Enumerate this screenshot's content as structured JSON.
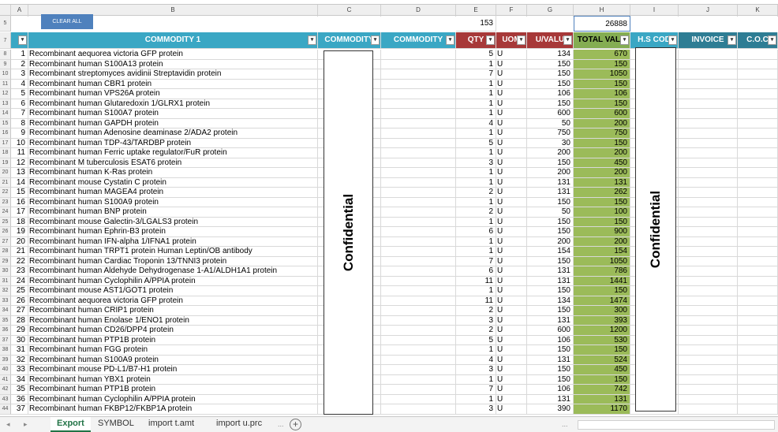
{
  "column_letters": [
    "A",
    "B",
    "C",
    "D",
    "E",
    "F",
    "G",
    "H",
    "I",
    "J",
    "K"
  ],
  "toolbar": {
    "clear_all": "CLEAR ALL",
    "qty_total": "153",
    "value_total": "26888"
  },
  "headers": [
    {
      "key": "no",
      "label": ""
    },
    {
      "key": "commodity1",
      "label": "COMMODITY 1"
    },
    {
      "key": "commodity2",
      "label": "COMMODITY"
    },
    {
      "key": "commodity3",
      "label": "COMMODITY"
    },
    {
      "key": "qty",
      "label": "QTY"
    },
    {
      "key": "uom",
      "label": "UOM"
    },
    {
      "key": "uvalue",
      "label": "U/VALU"
    },
    {
      "key": "total",
      "label": "TOTAL VALU"
    },
    {
      "key": "hscode",
      "label": "H.S COD"
    },
    {
      "key": "invoice",
      "label": "INVOICE"
    },
    {
      "key": "coo",
      "label": "C.O.C"
    }
  ],
  "filter_icon": "dropdown-arrow-icon",
  "confidential_label": "Confidential",
  "rows": [
    {
      "r": "8",
      "no": "1",
      "name": "Recombinant aequorea victoria GFP protein",
      "qty": "5",
      "uom": "U",
      "uval": "134",
      "total": "670"
    },
    {
      "r": "9",
      "no": "2",
      "name": "Recombinant human S100A13 protein",
      "qty": "1",
      "uom": "U",
      "uval": "150",
      "total": "150"
    },
    {
      "r": "10",
      "no": "3",
      "name": "Recombinant streptomyces avidinii Streptavidin protein",
      "qty": "7",
      "uom": "U",
      "uval": "150",
      "total": "1050"
    },
    {
      "r": "11",
      "no": "4",
      "name": "Recombinant human CBR1 protein",
      "qty": "1",
      "uom": "U",
      "uval": "150",
      "total": "150"
    },
    {
      "r": "12",
      "no": "5",
      "name": "Recombinant human VPS26A protein",
      "qty": "1",
      "uom": "U",
      "uval": "106",
      "total": "106"
    },
    {
      "r": "13",
      "no": "6",
      "name": "Recombinant human Glutaredoxin 1/GLRX1 protein",
      "qty": "1",
      "uom": "U",
      "uval": "150",
      "total": "150"
    },
    {
      "r": "14",
      "no": "7",
      "name": "Recombinant human S100A7 protein",
      "qty": "1",
      "uom": "U",
      "uval": "600",
      "total": "600"
    },
    {
      "r": "15",
      "no": "8",
      "name": "Recombinant human GAPDH protein",
      "qty": "4",
      "uom": "U",
      "uval": "50",
      "total": "200"
    },
    {
      "r": "16",
      "no": "9",
      "name": "Recombinant human Adenosine deaminase 2/ADA2 protein",
      "qty": "1",
      "uom": "U",
      "uval": "750",
      "total": "750"
    },
    {
      "r": "17",
      "no": "10",
      "name": "Recombinant human TDP-43/TARDBP protein",
      "qty": "5",
      "uom": "U",
      "uval": "30",
      "total": "150"
    },
    {
      "r": "18",
      "no": "11",
      "name": "Recombinant human Ferric uptake regulator/FuR protein",
      "qty": "1",
      "uom": "U",
      "uval": "200",
      "total": "200"
    },
    {
      "r": "19",
      "no": "12",
      "name": "Recombinant M tuberculosis ESAT6 protein",
      "qty": "3",
      "uom": "U",
      "uval": "150",
      "total": "450"
    },
    {
      "r": "20",
      "no": "13",
      "name": "Recombinant human K-Ras protein",
      "qty": "1",
      "uom": "U",
      "uval": "200",
      "total": "200"
    },
    {
      "r": "21",
      "no": "14",
      "name": "Recombinant mouse Cystatin C protein",
      "qty": "1",
      "uom": "U",
      "uval": "131",
      "total": "131"
    },
    {
      "r": "22",
      "no": "15",
      "name": "Recombinant human MAGEA4 protein",
      "qty": "2",
      "uom": "U",
      "uval": "131",
      "total": "262"
    },
    {
      "r": "23",
      "no": "16",
      "name": "Recombinant human S100A9 protein",
      "qty": "1",
      "uom": "U",
      "uval": "150",
      "total": "150"
    },
    {
      "r": "24",
      "no": "17",
      "name": "Recombinant human BNP protein",
      "qty": "2",
      "uom": "U",
      "uval": "50",
      "total": "100"
    },
    {
      "r": "25",
      "no": "18",
      "name": "Recombinant mouse Galectin-3/LGALS3 protein",
      "qty": "1",
      "uom": "U",
      "uval": "150",
      "total": "150"
    },
    {
      "r": "26",
      "no": "19",
      "name": "Recombinant human Ephrin-B3 protein",
      "qty": "6",
      "uom": "U",
      "uval": "150",
      "total": "900"
    },
    {
      "r": "27",
      "no": "20",
      "name": "Recombinant human IFN-alpha 1/IFNA1 protein",
      "qty": "1",
      "uom": "U",
      "uval": "200",
      "total": "200"
    },
    {
      "r": "28",
      "no": "21",
      "name": "Recombinant human TRPT1 protein Human Leptin/OB antibody",
      "qty": "1",
      "uom": "U",
      "uval": "154",
      "total": "154"
    },
    {
      "r": "29",
      "no": "22",
      "name": "Recombinant human Cardiac Troponin 13/TNNI3 protein",
      "qty": "7",
      "uom": "U",
      "uval": "150",
      "total": "1050"
    },
    {
      "r": "30",
      "no": "23",
      "name": "Recombinant human Aldehyde Dehydrogenase 1-A1/ALDH1A1 protein",
      "qty": "6",
      "uom": "U",
      "uval": "131",
      "total": "786"
    },
    {
      "r": "31",
      "no": "24",
      "name": "Recombinant human Cyclophilin A/PPIA protein",
      "qty": "11",
      "uom": "U",
      "uval": "131",
      "total": "1441"
    },
    {
      "r": "32",
      "no": "25",
      "name": "Recombinant mouse AST1/GOT1 protein",
      "qty": "1",
      "uom": "U",
      "uval": "150",
      "total": "150"
    },
    {
      "r": "33",
      "no": "26",
      "name": "Recombinant aequorea victoria GFP protein",
      "qty": "11",
      "uom": "U",
      "uval": "134",
      "total": "1474"
    },
    {
      "r": "34",
      "no": "27",
      "name": "Recombinant human CRIP1 protein",
      "qty": "2",
      "uom": "U",
      "uval": "150",
      "total": "300"
    },
    {
      "r": "35",
      "no": "28",
      "name": "Recombinant human Enolase 1/ENO1 protein",
      "qty": "3",
      "uom": "U",
      "uval": "131",
      "total": "393"
    },
    {
      "r": "36",
      "no": "29",
      "name": "Recombinant human CD26/DPP4 protein",
      "qty": "2",
      "uom": "U",
      "uval": "600",
      "total": "1200"
    },
    {
      "r": "37",
      "no": "30",
      "name": "Recombinant human PTP1B protein",
      "qty": "5",
      "uom": "U",
      "uval": "106",
      "total": "530"
    },
    {
      "r": "38",
      "no": "31",
      "name": "Recombinant human FGG protein",
      "qty": "1",
      "uom": "U",
      "uval": "150",
      "total": "150"
    },
    {
      "r": "39",
      "no": "32",
      "name": "Recombinant human S100A9 protein",
      "qty": "4",
      "uom": "U",
      "uval": "131",
      "total": "524"
    },
    {
      "r": "40",
      "no": "33",
      "name": "Recombinant mouse PD-L1/B7-H1 protein",
      "qty": "3",
      "uom": "U",
      "uval": "150",
      "total": "450"
    },
    {
      "r": "41",
      "no": "34",
      "name": "Recombinant human YBX1 protein",
      "qty": "1",
      "uom": "U",
      "uval": "150",
      "total": "150"
    },
    {
      "r": "42",
      "no": "35",
      "name": "Recombinant human PTP1B protein",
      "qty": "7",
      "uom": "U",
      "uval": "106",
      "total": "742"
    },
    {
      "r": "43",
      "no": "36",
      "name": "Recombinant human Cyclophilin A/PPIA protein",
      "qty": "1",
      "uom": "U",
      "uval": "131",
      "total": "131"
    },
    {
      "r": "44",
      "no": "37",
      "name": "Recombinant human FKBP12/FKBP1A protein",
      "qty": "3",
      "uom": "U",
      "uval": "390",
      "total": "1170"
    }
  ],
  "header_rows": {
    "top": "5",
    "header": "7"
  },
  "sheet_tabs": [
    {
      "label": "Export",
      "active": true
    },
    {
      "label": "SYMBOL",
      "active": false
    },
    {
      "label": "import t.amt",
      "active": false
    },
    {
      "label": "import u.prc",
      "active": false
    }
  ],
  "tab_nav": {
    "prev": "◂",
    "next": "▸",
    "more": "...",
    "add": "+"
  },
  "colors": {
    "teal_header": "#3aa7c4",
    "red_header": "#a73838",
    "green_total": "#9bbb59",
    "button_blue": "#4f81bd"
  }
}
